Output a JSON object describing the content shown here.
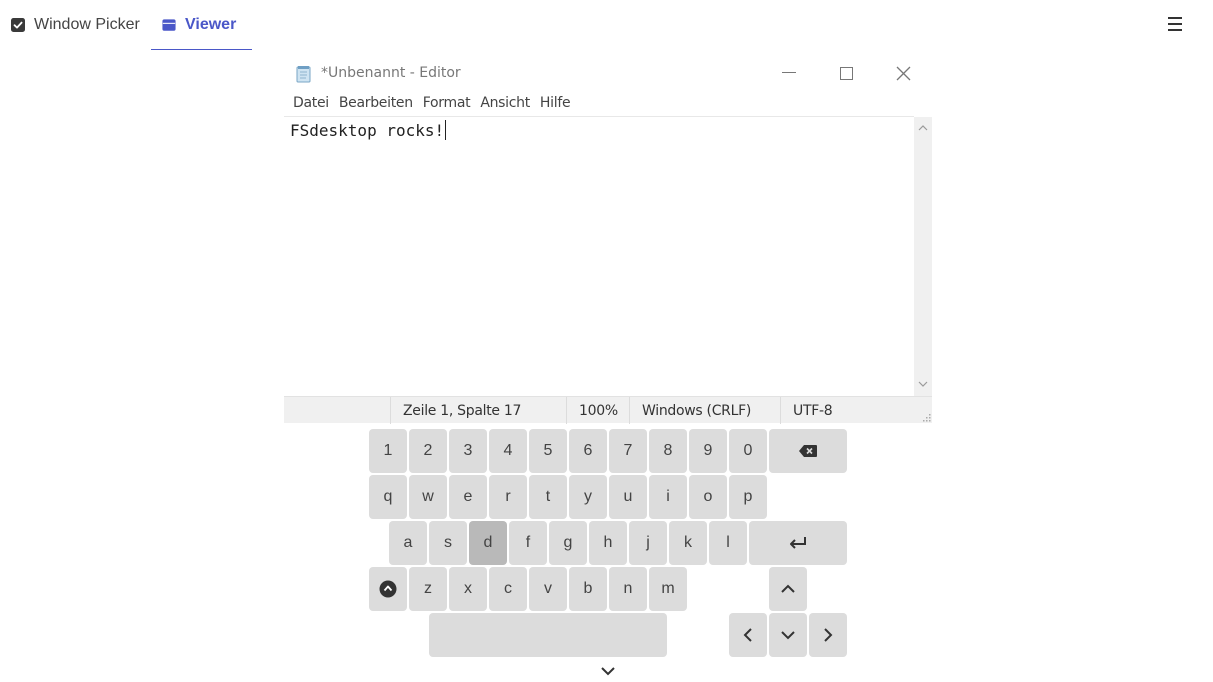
{
  "nav": {
    "tabs": [
      {
        "label": "Window Picker",
        "icon": "checkbox-icon",
        "active": false
      },
      {
        "label": "Viewer",
        "icon": "window-icon",
        "active": true
      }
    ],
    "menu_icon": "hamburger-menu-icon",
    "accent_color": "#4a57c8"
  },
  "window": {
    "title": "*Unbenannt - Editor",
    "menu": [
      "Datei",
      "Bearbeiten",
      "Format",
      "Ansicht",
      "Hilfe"
    ],
    "content": "FSdesktop rocks!",
    "status": {
      "position": "Zeile 1, Spalte 17",
      "zoom": "100%",
      "line_ending": "Windows (CRLF)",
      "encoding": "UTF-8"
    }
  },
  "keyboard": {
    "row1": [
      "1",
      "2",
      "3",
      "4",
      "5",
      "6",
      "7",
      "8",
      "9",
      "0"
    ],
    "row2": [
      "q",
      "w",
      "e",
      "r",
      "t",
      "y",
      "u",
      "i",
      "o",
      "p"
    ],
    "row3": [
      "a",
      "s",
      "d",
      "f",
      "g",
      "h",
      "j",
      "k",
      "l"
    ],
    "row4": [
      "z",
      "x",
      "c",
      "v",
      "b",
      "n",
      "m"
    ],
    "pressed_key": "d",
    "key_color": "#dcdcdc",
    "pressed_color": "#b9b9b9"
  }
}
